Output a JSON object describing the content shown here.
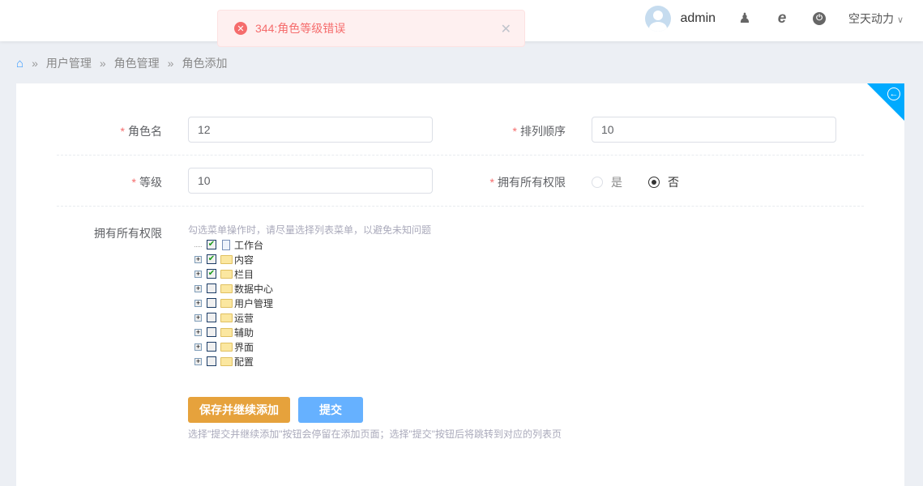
{
  "header": {
    "username": "admin",
    "site": "空天动力"
  },
  "toast": {
    "message": "344:角色等级错误"
  },
  "breadcrumb": [
    "用户管理",
    "角色管理",
    "角色添加"
  ],
  "form": {
    "role_name": {
      "label": "角色名",
      "value": "12"
    },
    "sort_order": {
      "label": "排列顺序",
      "value": "10"
    },
    "level": {
      "label": "等级",
      "value": "10"
    },
    "all_perms": {
      "label": "拥有所有权限",
      "yes": "是",
      "no": "否",
      "selected": "否"
    },
    "perms": {
      "label": "拥有所有权限",
      "hint": "勾选菜单操作时，请尽量选择列表菜单，以避免未知问题",
      "tree": [
        {
          "label": "工作台",
          "checked": true
        },
        {
          "label": "内容",
          "checked": true
        },
        {
          "label": "栏目",
          "checked": true
        },
        {
          "label": "数据中心",
          "checked": false
        },
        {
          "label": "用户管理",
          "checked": false
        },
        {
          "label": "运营",
          "checked": false
        },
        {
          "label": "辅助",
          "checked": false
        },
        {
          "label": "界面",
          "checked": false
        },
        {
          "label": "配置",
          "checked": false
        }
      ]
    },
    "save_continue": "保存并继续添加",
    "submit": "提交",
    "footer_hint": "选择\"提交并继续添加\"按钮会停留在添加页面；选择\"提交\"按钮后将跳转到对应的列表页"
  },
  "colors": {
    "accent": "#00aaff",
    "save": "#e6a23c",
    "submit": "#66b1ff",
    "error": "#f56c6c"
  }
}
